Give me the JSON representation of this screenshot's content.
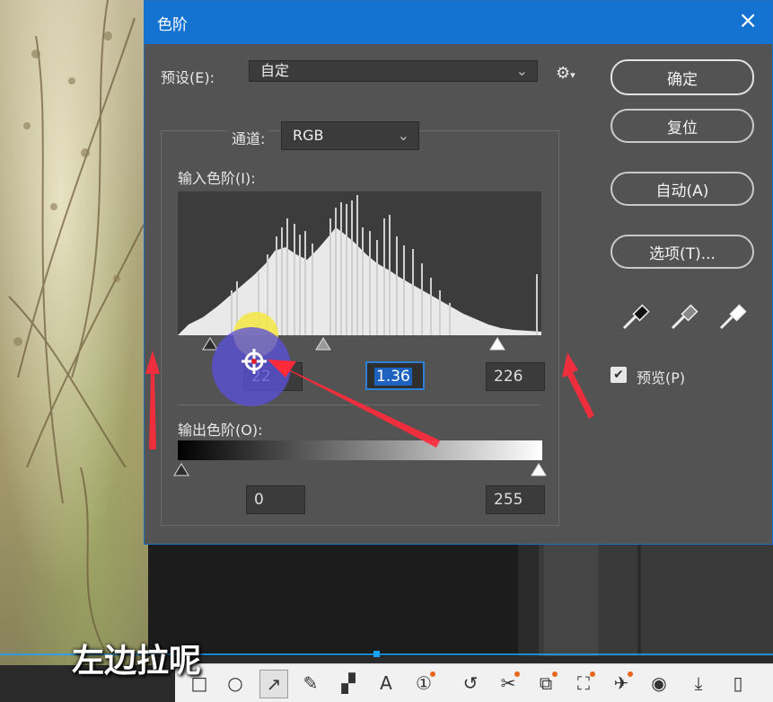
{
  "caption": "左边拉呢",
  "dialog": {
    "title": "色阶",
    "close_icon": "×",
    "preset_label": "预设(E):",
    "preset_value": "自定",
    "channel_label": "通道:",
    "channel_value": "RGB",
    "input_levels_label": "输入色阶(I):",
    "input_black": "22",
    "input_gamma": "1.36",
    "input_white": "226",
    "output_levels_label": "输出色阶(O):",
    "output_black": "0",
    "output_white": "255",
    "buttons": {
      "ok": "确定",
      "reset": "复位",
      "auto": "自动(A)",
      "options": "选项(T)..."
    },
    "preview_label": "预览(P)",
    "preview_checked": true
  },
  "colors": {
    "titlebar": "#1473d0",
    "dialog_bg": "#535353",
    "annotation_red": "#ff2a3a",
    "annotation_highlight": "#f5e642",
    "annotation_circle": "#5a4fd8"
  },
  "icons": {
    "settings": "gear-icon",
    "dropdown": "chevron-down-icon",
    "black_eyedropper": "eyedropper-black-icon",
    "gray_eyedropper": "eyedropper-gray-icon",
    "white_eyedropper": "eyedropper-white-icon"
  }
}
